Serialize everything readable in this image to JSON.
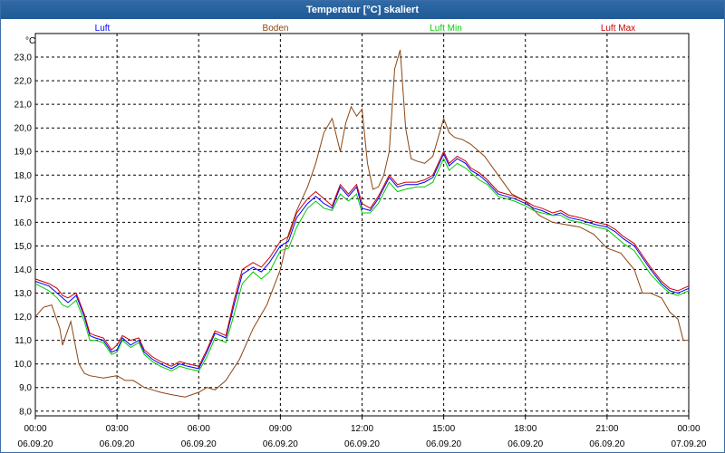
{
  "window_title": "Temperatur [°C] skaliert",
  "chart_data": {
    "type": "line",
    "title": "Temperatur [°C] skaliert",
    "ylabel": "°C",
    "ylim": [
      7.8,
      24.0
    ],
    "y_ticks": [
      "8,0",
      "9,0",
      "10,0",
      "11,0",
      "12,0",
      "13,0",
      "14,0",
      "15,0",
      "16,0",
      "17,0",
      "18,0",
      "19,0",
      "20,0",
      "21,0",
      "22,0",
      "23,0"
    ],
    "y_tick_values": [
      8,
      9,
      10,
      11,
      12,
      13,
      14,
      15,
      16,
      17,
      18,
      19,
      20,
      21,
      22,
      23
    ],
    "xlim": [
      0,
      24
    ],
    "x_ticks": [
      {
        "x": 0,
        "time": "00:00",
        "date": "06.09.20"
      },
      {
        "x": 3,
        "time": "03:00",
        "date": "06.09.20"
      },
      {
        "x": 6,
        "time": "06:00",
        "date": "06.09.20"
      },
      {
        "x": 9,
        "time": "09:00",
        "date": "06.09.20"
      },
      {
        "x": 12,
        "time": "12:00",
        "date": "06.09.20"
      },
      {
        "x": 15,
        "time": "15:00",
        "date": "06.09.20"
      },
      {
        "x": 18,
        "time": "18:00",
        "date": "06.09.20"
      },
      {
        "x": 21,
        "time": "21:00",
        "date": "06.09.20"
      },
      {
        "x": 24,
        "time": "00:00",
        "date": "07.09.20"
      }
    ],
    "grid": true,
    "series": [
      {
        "name": "Boden",
        "color": "#8b4513",
        "x": [
          0,
          0.3,
          0.6,
          0.9,
          1.0,
          1.3,
          1.6,
          1.8,
          2.0,
          2.5,
          3.0,
          3.3,
          3.6,
          4.0,
          4.3,
          4.6,
          5.0,
          5.5,
          6.0,
          6.3,
          6.6,
          7.0,
          7.5,
          8.0,
          8.5,
          9.0,
          9.3,
          9.6,
          10.0,
          10.3,
          10.6,
          10.9,
          11.2,
          11.4,
          11.6,
          11.8,
          12.0,
          12.2,
          12.4,
          12.6,
          12.8,
          13.0,
          13.2,
          13.4,
          13.6,
          13.8,
          14.0,
          14.3,
          14.6,
          15.0,
          15.2,
          15.4,
          15.7,
          16.0,
          16.5,
          17.0,
          17.5,
          18.0,
          18.5,
          19.0,
          19.5,
          20.0,
          20.5,
          21.0,
          21.5,
          22.0,
          22.3,
          22.6,
          23.0,
          23.3,
          23.6,
          23.8,
          24.0
        ],
        "values": [
          12.0,
          12.4,
          12.5,
          11.5,
          10.8,
          11.8,
          10.0,
          9.6,
          9.5,
          9.4,
          9.5,
          9.3,
          9.3,
          9.0,
          8.9,
          8.8,
          8.7,
          8.6,
          8.8,
          9.0,
          8.9,
          9.3,
          10.2,
          11.5,
          12.5,
          14.0,
          15.5,
          16.5,
          17.5,
          18.5,
          19.8,
          20.4,
          19.0,
          20.2,
          20.9,
          20.5,
          20.8,
          18.5,
          17.4,
          17.5,
          18.0,
          19.0,
          22.5,
          23.3,
          20.0,
          18.7,
          18.6,
          18.5,
          18.8,
          20.4,
          19.8,
          19.6,
          19.5,
          19.3,
          18.8,
          18.0,
          17.2,
          16.9,
          16.3,
          16.0,
          15.9,
          15.8,
          15.5,
          14.9,
          14.7,
          14.0,
          13.0,
          13.0,
          12.8,
          12.2,
          11.9,
          11.0,
          11.0
        ]
      },
      {
        "name": "Luft",
        "color": "#0000ff",
        "x": [
          0,
          0.5,
          0.8,
          1.0,
          1.2,
          1.5,
          1.8,
          2.0,
          2.2,
          2.5,
          2.8,
          3.0,
          3.2,
          3.5,
          3.8,
          4.0,
          4.3,
          4.6,
          5.0,
          5.3,
          5.6,
          6.0,
          6.3,
          6.6,
          7.0,
          7.3,
          7.6,
          8.0,
          8.3,
          8.6,
          9.0,
          9.3,
          9.6,
          10.0,
          10.3,
          10.6,
          10.9,
          11.2,
          11.5,
          11.8,
          12.0,
          12.3,
          12.6,
          13.0,
          13.3,
          13.6,
          14.0,
          14.3,
          14.6,
          15.0,
          15.2,
          15.5,
          15.8,
          16.0,
          16.3,
          16.6,
          17.0,
          17.3,
          17.6,
          18.0,
          18.3,
          18.6,
          19.0,
          19.3,
          19.6,
          20.0,
          20.3,
          20.6,
          21.0,
          21.3,
          21.6,
          22.0,
          22.3,
          22.6,
          23.0,
          23.3,
          23.6,
          24.0
        ],
        "values": [
          13.5,
          13.3,
          13.0,
          12.8,
          12.6,
          12.9,
          12.0,
          11.2,
          11.1,
          11.0,
          10.5,
          10.6,
          11.1,
          10.8,
          11.0,
          10.5,
          10.2,
          10.0,
          9.8,
          10.0,
          9.9,
          9.8,
          10.5,
          11.3,
          11.1,
          12.5,
          13.8,
          14.1,
          13.9,
          14.3,
          15.0,
          15.2,
          16.2,
          16.8,
          17.1,
          16.8,
          16.6,
          17.5,
          17.1,
          17.5,
          16.6,
          16.5,
          17.0,
          17.9,
          17.5,
          17.6,
          17.6,
          17.7,
          17.9,
          18.9,
          18.4,
          18.7,
          18.5,
          18.2,
          18.0,
          17.7,
          17.2,
          17.1,
          17.0,
          16.8,
          16.6,
          16.5,
          16.3,
          16.4,
          16.2,
          16.1,
          16.0,
          15.9,
          15.8,
          15.6,
          15.3,
          15.0,
          14.5,
          14.0,
          13.4,
          13.1,
          13.0,
          13.2
        ]
      },
      {
        "name": "Luft Min",
        "color": "#00cc00",
        "x": [
          0,
          0.5,
          0.8,
          1.0,
          1.2,
          1.5,
          1.8,
          2.0,
          2.2,
          2.5,
          2.8,
          3.0,
          3.2,
          3.5,
          3.8,
          4.0,
          4.3,
          4.6,
          5.0,
          5.3,
          5.6,
          6.0,
          6.3,
          6.6,
          7.0,
          7.3,
          7.6,
          8.0,
          8.3,
          8.6,
          9.0,
          9.3,
          9.6,
          10.0,
          10.3,
          10.6,
          10.9,
          11.2,
          11.5,
          11.8,
          12.0,
          12.3,
          12.6,
          13.0,
          13.3,
          13.6,
          14.0,
          14.3,
          14.6,
          15.0,
          15.2,
          15.5,
          15.8,
          16.0,
          16.3,
          16.6,
          17.0,
          17.3,
          17.6,
          18.0,
          18.3,
          18.6,
          19.0,
          19.3,
          19.6,
          20.0,
          20.3,
          20.6,
          21.0,
          21.3,
          21.6,
          22.0,
          22.3,
          22.6,
          23.0,
          23.3,
          23.6,
          24.0
        ],
        "values": [
          13.4,
          13.1,
          12.8,
          12.5,
          12.4,
          12.7,
          11.8,
          11.0,
          11.0,
          10.9,
          10.4,
          10.5,
          11.0,
          10.7,
          10.9,
          10.4,
          10.1,
          9.9,
          9.7,
          9.9,
          9.8,
          9.7,
          10.3,
          11.1,
          10.9,
          12.1,
          13.4,
          13.9,
          13.6,
          13.9,
          14.8,
          14.9,
          15.8,
          16.6,
          16.9,
          16.6,
          16.5,
          17.2,
          16.9,
          17.2,
          16.4,
          16.4,
          16.8,
          17.7,
          17.3,
          17.4,
          17.5,
          17.5,
          17.7,
          18.7,
          18.2,
          18.5,
          18.3,
          18.1,
          17.8,
          17.6,
          17.1,
          17.0,
          16.9,
          16.7,
          16.5,
          16.4,
          16.3,
          16.3,
          16.1,
          16.0,
          15.9,
          15.8,
          15.7,
          15.4,
          15.1,
          14.8,
          14.3,
          13.8,
          13.3,
          13.0,
          12.9,
          13.1
        ]
      },
      {
        "name": "Luft Max",
        "color": "#cc0000",
        "x": [
          0,
          0.5,
          0.8,
          1.0,
          1.2,
          1.5,
          1.8,
          2.0,
          2.2,
          2.5,
          2.8,
          3.0,
          3.2,
          3.5,
          3.8,
          4.0,
          4.3,
          4.6,
          5.0,
          5.3,
          5.6,
          6.0,
          6.3,
          6.6,
          7.0,
          7.3,
          7.6,
          8.0,
          8.3,
          8.6,
          9.0,
          9.3,
          9.6,
          10.0,
          10.3,
          10.6,
          10.9,
          11.2,
          11.5,
          11.8,
          12.0,
          12.3,
          12.6,
          13.0,
          13.3,
          13.6,
          14.0,
          14.3,
          14.6,
          15.0,
          15.2,
          15.5,
          15.8,
          16.0,
          16.3,
          16.6,
          17.0,
          17.3,
          17.6,
          18.0,
          18.3,
          18.6,
          19.0,
          19.3,
          19.6,
          20.0,
          20.3,
          20.6,
          21.0,
          21.3,
          21.6,
          22.0,
          22.3,
          22.6,
          23.0,
          23.3,
          23.6,
          24.0
        ],
        "values": [
          13.6,
          13.4,
          13.2,
          12.9,
          12.8,
          13.0,
          12.1,
          11.3,
          11.2,
          11.1,
          10.6,
          10.8,
          11.2,
          11.0,
          11.1,
          10.6,
          10.3,
          10.1,
          9.9,
          10.1,
          10.0,
          9.9,
          10.6,
          11.4,
          11.2,
          12.7,
          14.0,
          14.3,
          14.1,
          14.5,
          15.2,
          15.4,
          16.4,
          17.0,
          17.3,
          17.0,
          16.7,
          17.6,
          17.2,
          17.6,
          16.8,
          16.6,
          17.1,
          18.0,
          17.6,
          17.7,
          17.7,
          17.8,
          18.0,
          19.0,
          18.5,
          18.8,
          18.6,
          18.3,
          18.1,
          17.8,
          17.3,
          17.2,
          17.1,
          16.9,
          16.7,
          16.6,
          16.4,
          16.5,
          16.3,
          16.2,
          16.1,
          16.0,
          15.9,
          15.7,
          15.4,
          15.1,
          14.6,
          14.1,
          13.5,
          13.2,
          13.1,
          13.3
        ]
      }
    ]
  }
}
